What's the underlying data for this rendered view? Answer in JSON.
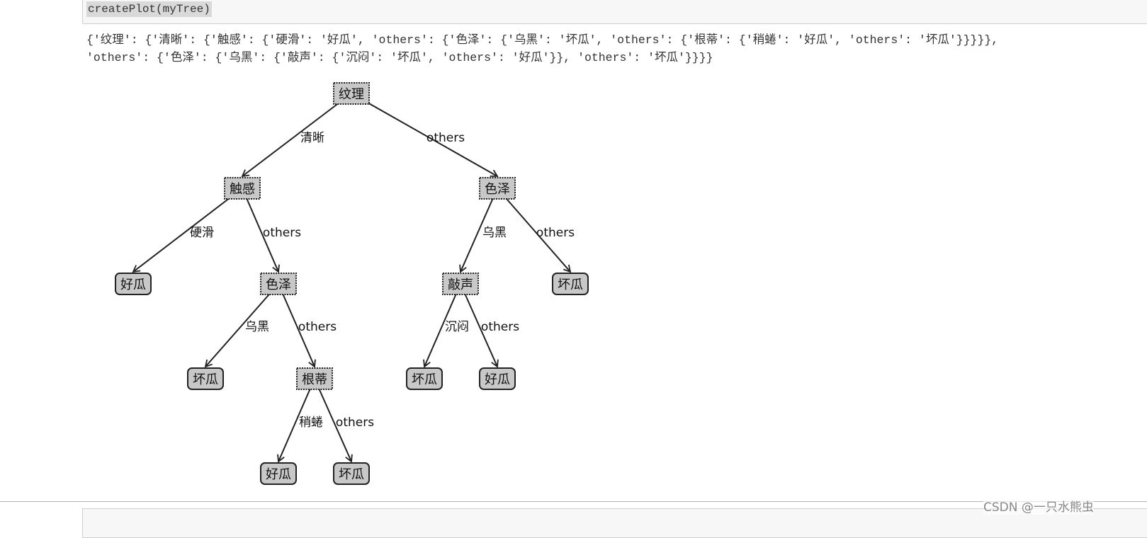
{
  "input_cell": {
    "code": "createPlot(myTree)"
  },
  "output_cell": {
    "text_line1": "{'纹理': {'清晰': {'触感': {'硬滑': '好瓜', 'others': {'色泽': {'乌黑': '坏瓜', 'others': {'根蒂': {'稍蜷': '好瓜', 'others': '坏瓜'}}}}},",
    "text_line2": "'others': {'色泽': {'乌黑': {'敲声': {'沉闷': '坏瓜', 'others': '好瓜'}}, 'others': '坏瓜'}}}}"
  },
  "tree": {
    "nodes": [
      {
        "label": "纹理",
        "type": "decision"
      },
      {
        "label": "触感",
        "type": "decision"
      },
      {
        "label": "色泽",
        "type": "decision"
      },
      {
        "label": "好瓜",
        "type": "leaf"
      },
      {
        "label": "色泽",
        "type": "decision"
      },
      {
        "label": "敲声",
        "type": "decision"
      },
      {
        "label": "坏瓜",
        "type": "leaf"
      },
      {
        "label": "坏瓜",
        "type": "leaf"
      },
      {
        "label": "根蒂",
        "type": "decision"
      },
      {
        "label": "坏瓜",
        "type": "leaf"
      },
      {
        "label": "好瓜",
        "type": "leaf"
      },
      {
        "label": "好瓜",
        "type": "leaf"
      },
      {
        "label": "坏瓜",
        "type": "leaf"
      }
    ],
    "edges": [
      {
        "from": 0,
        "to": 1,
        "label": "清晰"
      },
      {
        "from": 0,
        "to": 2,
        "label": "others"
      },
      {
        "from": 1,
        "to": 3,
        "label": "硬滑"
      },
      {
        "from": 1,
        "to": 4,
        "label": "others"
      },
      {
        "from": 2,
        "to": 5,
        "label": "乌黑"
      },
      {
        "from": 2,
        "to": 6,
        "label": "others"
      },
      {
        "from": 4,
        "to": 7,
        "label": "乌黑"
      },
      {
        "from": 4,
        "to": 8,
        "label": "others"
      },
      {
        "from": 5,
        "to": 9,
        "label": "沉闷"
      },
      {
        "from": 5,
        "to": 10,
        "label": "others"
      },
      {
        "from": 8,
        "to": 11,
        "label": "稍蜷"
      },
      {
        "from": 8,
        "to": 12,
        "label": "others"
      }
    ],
    "colors": {
      "node_fill": "#c8c8c8",
      "stroke": "#222222"
    }
  },
  "watermark": "CSDN @一只水熊虫"
}
